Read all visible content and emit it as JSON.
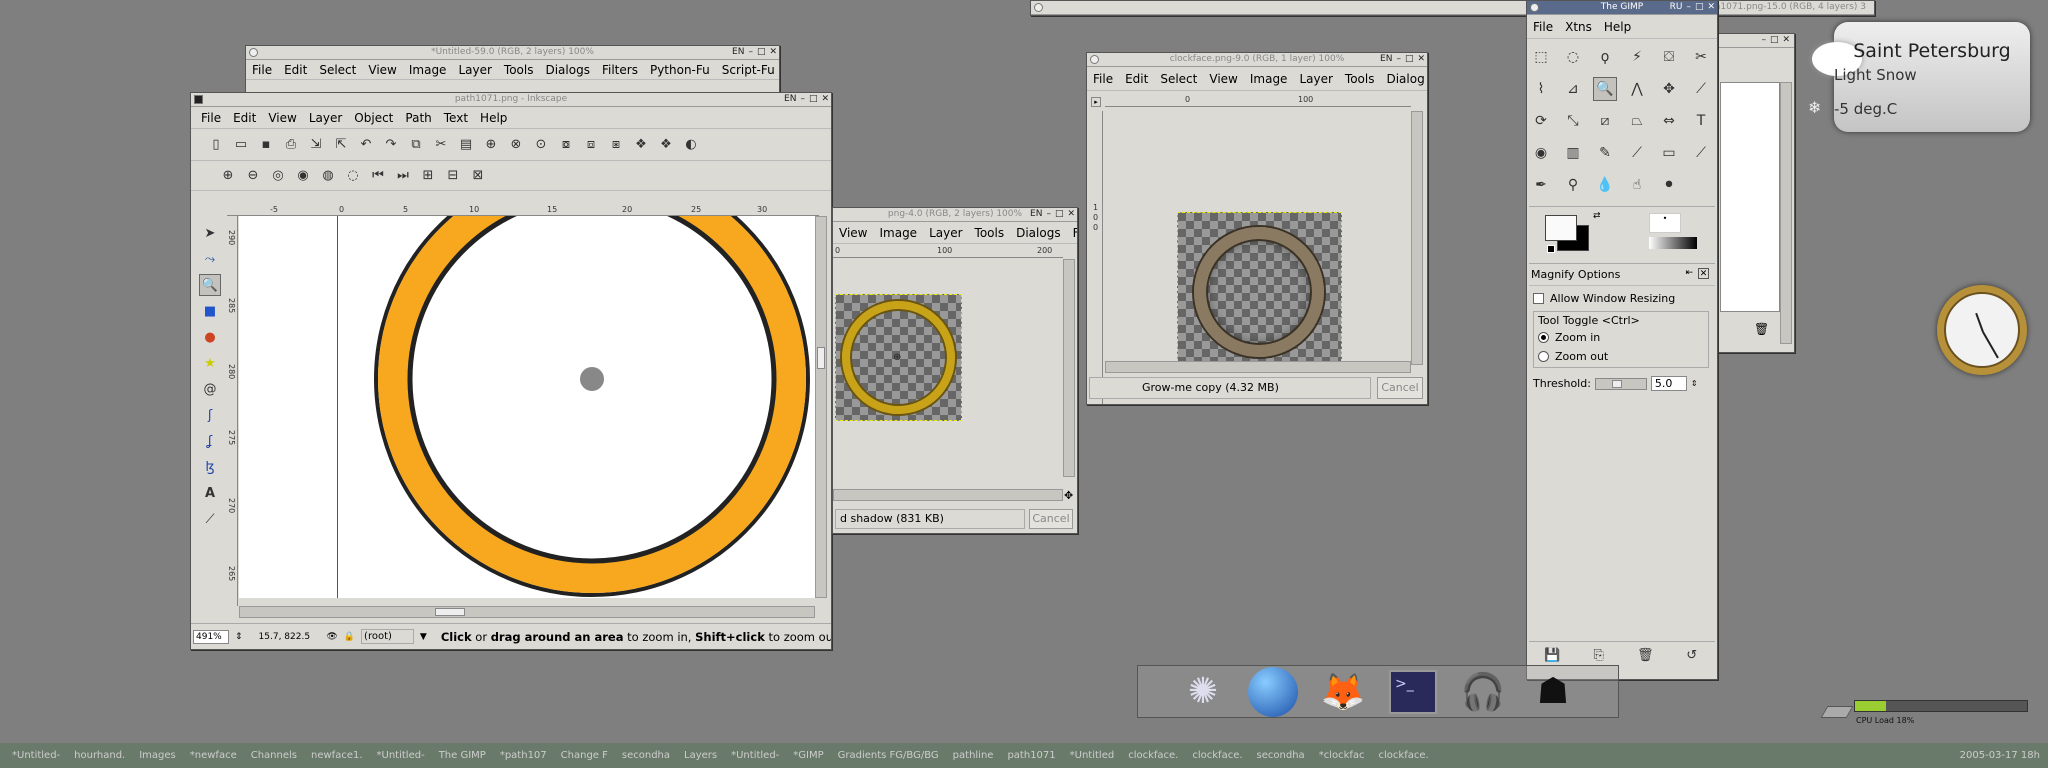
{
  "untitled_win": {
    "title": "*Untitled-59.0 (RGB, 2 layers) 100%",
    "lang": "EN",
    "menu": [
      "File",
      "Edit",
      "Select",
      "View",
      "Image",
      "Layer",
      "Tools",
      "Dialogs",
      "Filters",
      "Python-Fu",
      "Script-Fu"
    ]
  },
  "inkscape": {
    "title": "path1071.png - Inkscape",
    "lang": "EN",
    "menu": [
      "File",
      "Edit",
      "View",
      "Layer",
      "Object",
      "Path",
      "Text",
      "Help"
    ],
    "ruler_marks": [
      "-5",
      "0",
      "5",
      "10",
      "15",
      "20",
      "25",
      "30"
    ],
    "vruler_marks": [
      "290",
      "285",
      "280",
      "275",
      "270",
      "265"
    ],
    "zoom": "491%",
    "coords": "15.7,   822.5",
    "layer": "(root)",
    "status_b1": "Click",
    "status_t1": " or ",
    "status_b2": "drag around an area",
    "status_t2": " to zoom in, ",
    "status_b3": "Shift+click",
    "status_t3": " to zoom ou"
  },
  "path_win": {
    "title": "png-4.0 (RGB, 2 layers) 100%",
    "lang": "EN",
    "menu": [
      "View",
      "Image",
      "Layer",
      "Tools",
      "Dialogs",
      "F"
    ],
    "ruler_marks": [
      "0",
      "100",
      "200"
    ],
    "status": "d shadow (831 KB)",
    "cancel": "Cancel"
  },
  "clock_win": {
    "title": "clockface.png-9.0 (RGB, 1 layer) 100%",
    "lang": "EN",
    "menu": [
      "File",
      "Edit",
      "Select",
      "View",
      "Image",
      "Layer",
      "Tools",
      "Dialog"
    ],
    "ruler_marks": [
      "0",
      "100"
    ],
    "vruler_marks": [
      "1",
      "0",
      "0"
    ],
    "status": "Grow-me copy (4.32 MB)",
    "cancel": "Cancel"
  },
  "top_win": {
    "title": "*path1071.png-15.0 (RGB, 4 layers) 3"
  },
  "gimp": {
    "title": "The GIMP",
    "lang": "RU",
    "menu": [
      "File",
      "Xtns",
      "Help"
    ],
    "tools": [
      {
        "icon": "rect-select-icon",
        "g": "⬚"
      },
      {
        "icon": "ellipse-select-icon",
        "g": "◌"
      },
      {
        "icon": "lasso-icon",
        "g": "ϙ"
      },
      {
        "icon": "fuzzy-select-icon",
        "g": "⚡"
      },
      {
        "icon": "color-select-icon",
        "g": "⛋"
      },
      {
        "icon": "scissors-icon",
        "g": "✂"
      },
      {
        "icon": "paths-icon",
        "g": "⌇"
      },
      {
        "icon": "color-picker-icon",
        "g": "⊿"
      },
      {
        "icon": "magnify-icon",
        "g": "🔍"
      },
      {
        "icon": "measure-icon",
        "g": "⋀"
      },
      {
        "icon": "move-icon",
        "g": "✥"
      },
      {
        "icon": "crop-icon",
        "g": "⟋"
      },
      {
        "icon": "rotate-icon",
        "g": "⟳"
      },
      {
        "icon": "scale-icon",
        "g": "⤡"
      },
      {
        "icon": "shear-icon",
        "g": "⧄"
      },
      {
        "icon": "perspective-icon",
        "g": "⏢"
      },
      {
        "icon": "flip-icon",
        "g": "⇔"
      },
      {
        "icon": "text-icon",
        "g": "T"
      },
      {
        "icon": "bucket-fill-icon",
        "g": "◉"
      },
      {
        "icon": "blend-icon",
        "g": "▥"
      },
      {
        "icon": "pencil-icon",
        "g": "✎"
      },
      {
        "icon": "paintbrush-icon",
        "g": "⟋"
      },
      {
        "icon": "eraser-icon",
        "g": "▭"
      },
      {
        "icon": "airbrush-icon",
        "g": "⟋"
      },
      {
        "icon": "ink-icon",
        "g": "✒"
      },
      {
        "icon": "clone-icon",
        "g": "⚲"
      },
      {
        "icon": "blur-icon",
        "g": "💧"
      },
      {
        "icon": "smudge-icon",
        "g": "☝"
      },
      {
        "icon": "dodge-burn-icon",
        "g": "⚫"
      }
    ],
    "options_title": "Magnify Options",
    "allow_resize": "Allow Window Resizing",
    "tool_toggle": "Tool Toggle  <Ctrl>",
    "zoom_in": "Zoom in",
    "zoom_out": "Zoom out",
    "threshold_label": "Threshold:",
    "threshold_value": "5.0"
  },
  "weather": {
    "city": "Saint Petersburg",
    "condition": "Light Snow",
    "temp": "-5 deg.C"
  },
  "cpu": {
    "label": "CPU Load 18%",
    "load": 0.18
  },
  "taskbar": {
    "items": [
      "*Untitled-",
      "hourhand.",
      "Images",
      "*newface",
      "Channels",
      "newface1.",
      "*Untitled-",
      "The GIMP",
      "*path107",
      "Change F",
      "secondha",
      "Layers",
      "*Untitled-",
      "*GIMP",
      "Gradients FG/BG/BG",
      "pathline",
      "path1071",
      "*Untitled",
      "clockface.",
      "clockface.",
      "secondha",
      "*clockfac",
      "clockface."
    ],
    "clock": "2005-03-17 18h"
  }
}
